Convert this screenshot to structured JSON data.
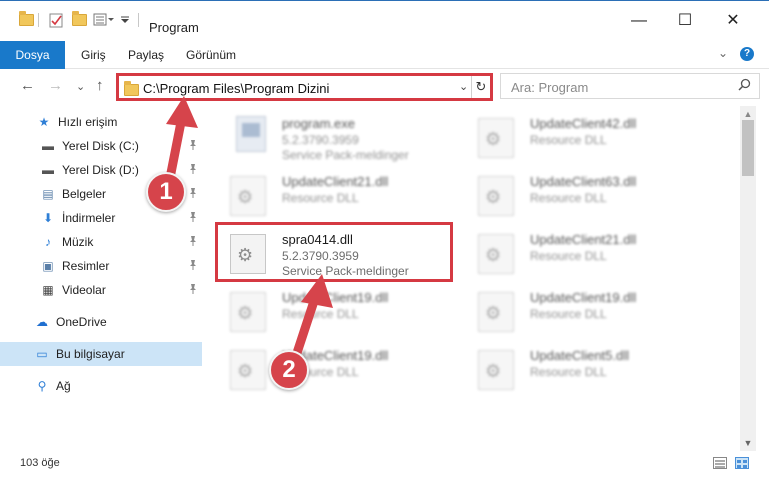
{
  "window": {
    "title": "Program",
    "minimize": "—",
    "maximize": "☐",
    "close": "✕"
  },
  "ribbon": {
    "tabs": [
      "Dosya",
      "Giriş",
      "Paylaş",
      "Görünüm"
    ],
    "expand": "⌄",
    "help": "?"
  },
  "nav": {
    "back": "←",
    "forward": "→",
    "recent": "⌄",
    "up": "↑",
    "address": "C:\\Program Files\\Program Dizini",
    "address_dropdown": "⌄",
    "refresh": "↻",
    "search_placeholder": "Ara: Program",
    "search_icon": "🔍"
  },
  "sidebar": {
    "items": [
      {
        "label": "Hızlı erişim",
        "icon": "★",
        "icon_name": "star-icon",
        "pinned": false
      },
      {
        "label": "Yerel Disk (C:)",
        "icon": "▬",
        "icon_name": "drive-icon",
        "pinned": true
      },
      {
        "label": "Yerel Disk (D:)",
        "icon": "▬",
        "icon_name": "drive-icon",
        "pinned": true
      },
      {
        "label": "Belgeler",
        "icon": "▤",
        "icon_name": "documents-icon",
        "pinned": true
      },
      {
        "label": "İndirmeler",
        "icon": "⬇",
        "icon_name": "downloads-icon",
        "pinned": true
      },
      {
        "label": "Müzik",
        "icon": "♪",
        "icon_name": "music-icon",
        "pinned": true
      },
      {
        "label": "Resimler",
        "icon": "▣",
        "icon_name": "pictures-icon",
        "pinned": true
      },
      {
        "label": "Videolar",
        "icon": "▦",
        "icon_name": "videos-icon",
        "pinned": true
      },
      {
        "label": "OneDrive",
        "icon": "☁",
        "icon_name": "cloud-icon",
        "pinned": false
      },
      {
        "label": "Bu bilgisayar",
        "icon": "▭",
        "icon_name": "computer-icon",
        "pinned": false,
        "selected": true
      },
      {
        "label": "Ağ",
        "icon": "⚲",
        "icon_name": "network-icon",
        "pinned": false
      }
    ],
    "pin_glyph": "📌"
  },
  "files": [
    {
      "name": "program.exe",
      "version": "5.2.3790.3959",
      "description": "Service Pack-meldinger",
      "kind": "exe"
    },
    {
      "name": "UpdateClient42.dll",
      "version": "Resource DLL",
      "description": "",
      "kind": "dll"
    },
    {
      "name": "UpdateClient21.dll",
      "version": "Resource DLL",
      "description": "",
      "kind": "dll"
    },
    {
      "name": "UpdateClient63.dll",
      "version": "Resource DLL",
      "description": "",
      "kind": "dll"
    },
    {
      "name": "spra0414.dll",
      "version": "5.2.3790.3959",
      "description": "Service Pack-meldinger",
      "kind": "dll",
      "highlighted": true
    },
    {
      "name": "UpdateClient21.dll",
      "version": "Resource DLL",
      "description": "",
      "kind": "dll"
    },
    {
      "name": "UpdateClient19.dll",
      "version": "Resource DLL",
      "description": "",
      "kind": "dll"
    },
    {
      "name": "UpdateClient19.dll",
      "version": "Resource DLL",
      "description": "",
      "kind": "dll"
    },
    {
      "name": "UpdateClient19.dll",
      "version": "Resource DLL",
      "description": "",
      "kind": "dll"
    },
    {
      "name": "UpdateClient5.dll",
      "version": "Resource DLL",
      "description": "",
      "kind": "dll"
    }
  ],
  "scrollbar": {
    "up": "▲",
    "down": "▼"
  },
  "status": {
    "count": "103 öğe"
  },
  "annotations": [
    {
      "number": "1"
    },
    {
      "number": "2"
    }
  ],
  "colors": {
    "accent": "#1979ca",
    "highlight": "#d53942",
    "badge": "#d6444b",
    "selection": "#cce4f7"
  }
}
